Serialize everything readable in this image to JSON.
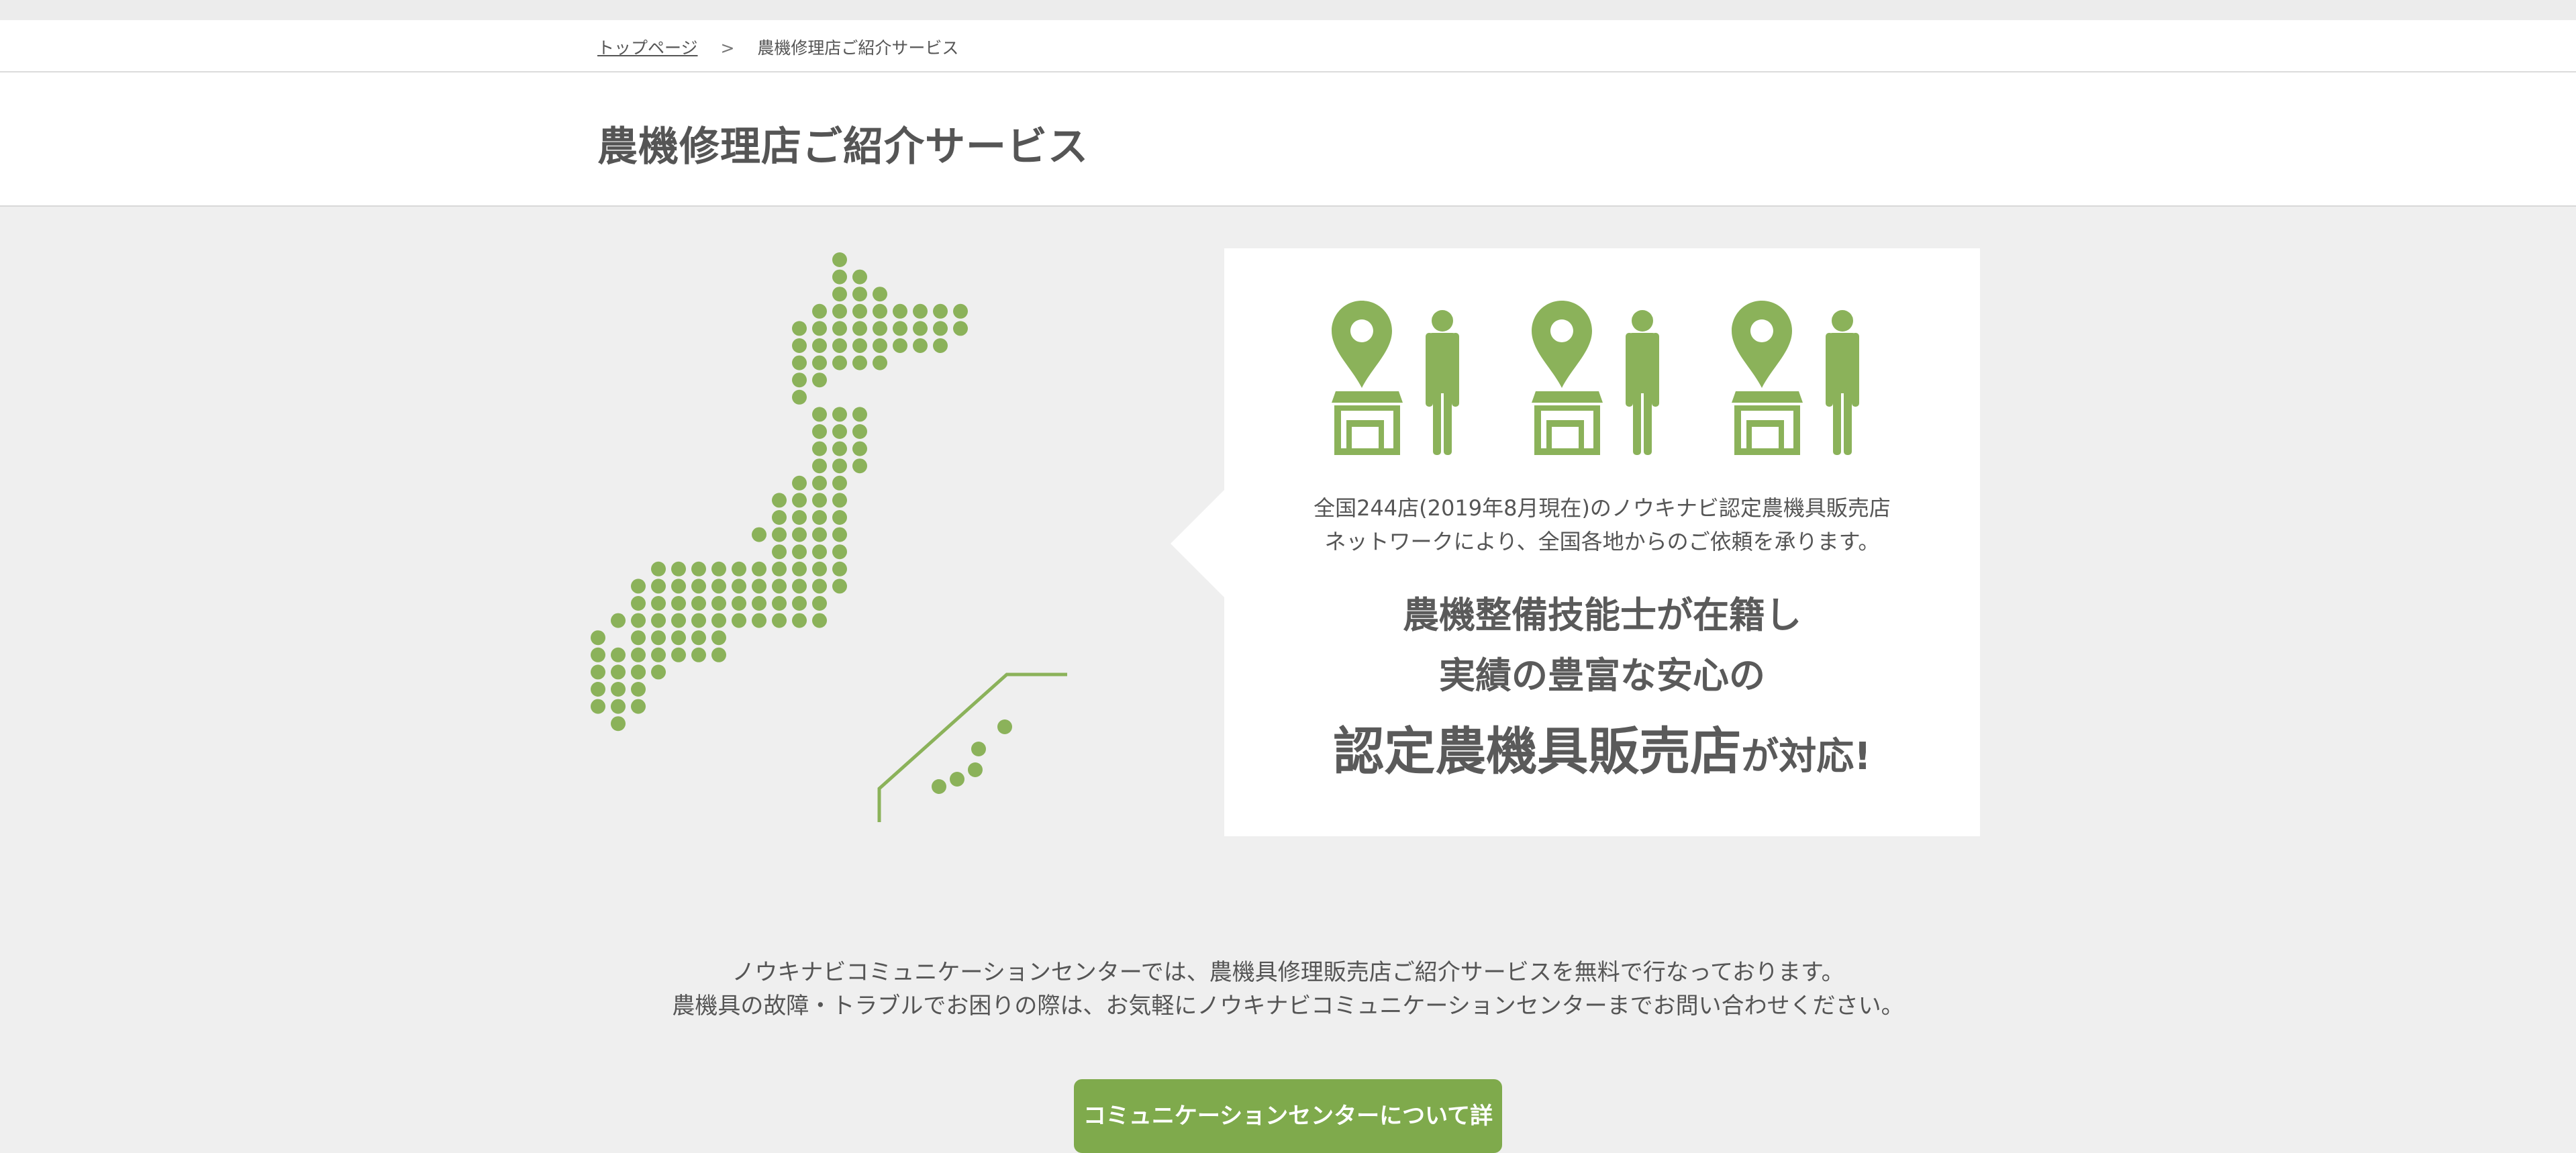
{
  "breadcrumb": {
    "home": "トップページ",
    "separator": ">",
    "current": "農機修理店ご紹介サービス"
  },
  "page": {
    "title": "農機修理店ご紹介サービス"
  },
  "info_card": {
    "network_lines": [
      "全国244店(2019年8月現在)のノウキナビ認定農機具販売店",
      "ネットワークにより、全国各地からのご依頼を承ります。"
    ],
    "headline_1": "農機整備技能士が在籍し",
    "headline_2": "実績の豊富な安心の",
    "headline_3_emphasis": "認定農機具販売店",
    "headline_3_suffix": "が対応!",
    "icons": [
      "map-pin-icon",
      "shop-icon",
      "staff-person-icon"
    ]
  },
  "intro": {
    "lines": [
      "ノウキナビコミュニケーションセンターでは、農機具修理販売店ご紹介サービスを無料で行なっております。",
      "農機具の故障・トラブルでお困りの際は、お気軽にノウキナビコミュニケーションセンターまでお問い合わせください。"
    ]
  },
  "cta": {
    "label": "コミュニケーションセンターについて詳"
  },
  "colors": {
    "accent_green": "#8bb25a",
    "button_green": "#7faa4c",
    "background": "#efefef",
    "text": "#555555"
  }
}
